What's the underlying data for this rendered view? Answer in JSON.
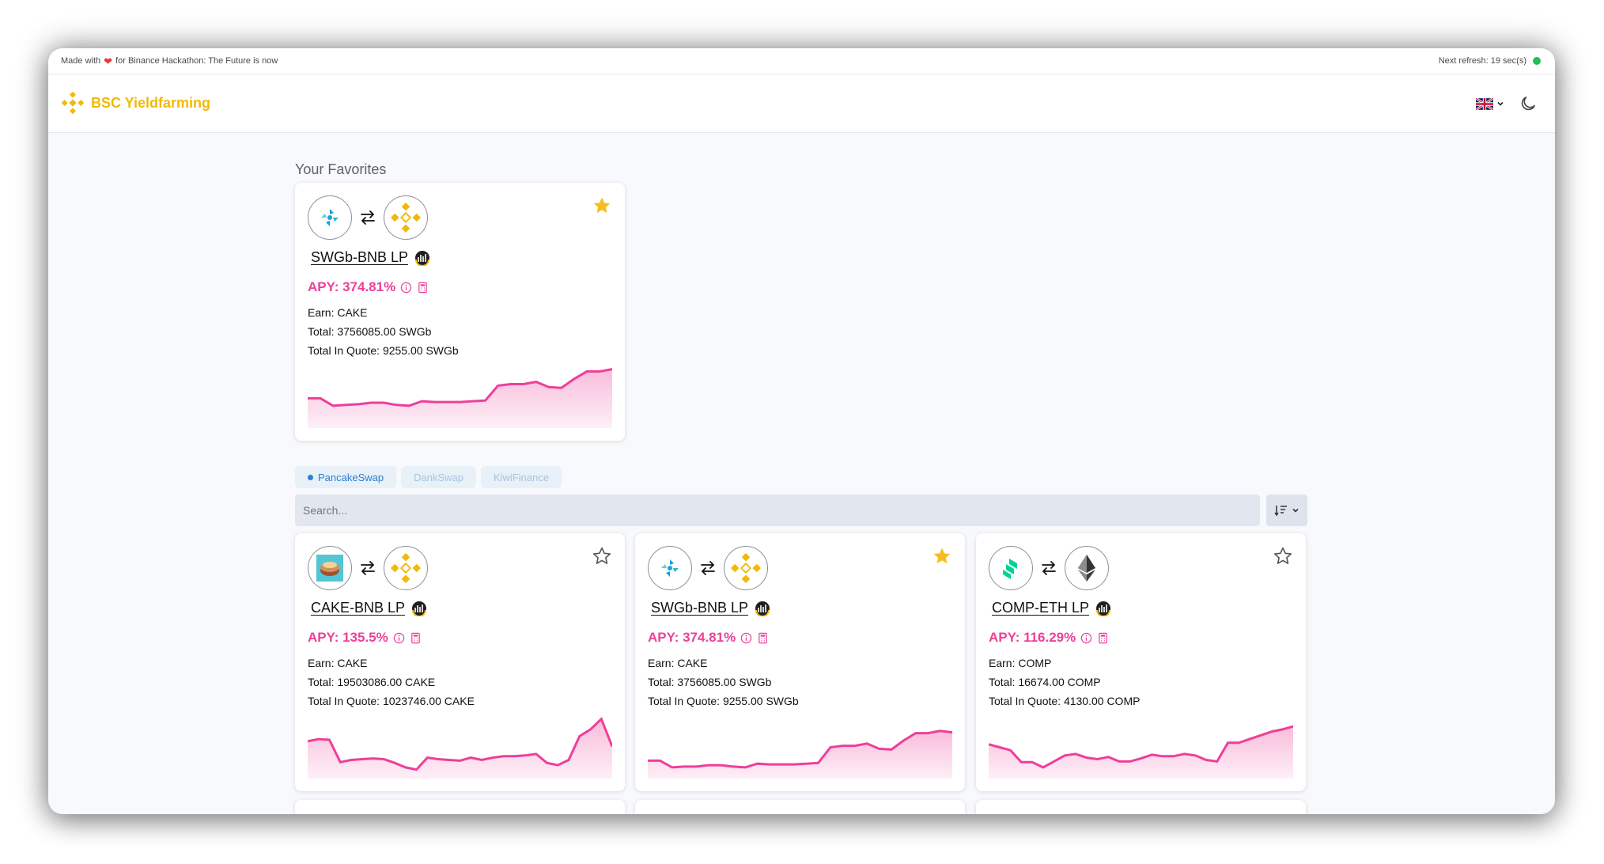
{
  "topbar": {
    "made_with": "Made with",
    "for_text": "for Binance Hackathon: The Future is now",
    "next_refresh": "Next refresh: 19 sec(s)"
  },
  "navbar": {
    "brand": "BSC Yieldfarming",
    "language_icon": "uk-flag-icon",
    "theme_icon": "moon-icon"
  },
  "favorites": {
    "title": "Your Favorites",
    "cards": [
      {
        "pair": "SWGb-BNB LP",
        "apy": "APY: 374.81%",
        "earn": "Earn: CAKE",
        "total": "Total: 3756085.00 SWGb",
        "total_quote": "Total In Quote: 9255.00 SWGb",
        "favorite": true,
        "token_a": "swgb-icon",
        "token_b": "bnb-icon",
        "spark": [
          40,
          40,
          30,
          31,
          32,
          34,
          34,
          31,
          30,
          36,
          35,
          35,
          35,
          36,
          37,
          57,
          59,
          59,
          62,
          55,
          54,
          66,
          76,
          76,
          79
        ]
      }
    ]
  },
  "tabs": [
    {
      "label": "PancakeSwap",
      "active": true
    },
    {
      "label": "DankSwap",
      "active": false
    },
    {
      "label": "KiwiFinance",
      "active": false
    }
  ],
  "search": {
    "placeholder": "Search..."
  },
  "sort_icon": "sort-desc-icon",
  "pools": [
    {
      "pair": "CAKE-BNB LP",
      "apy": "APY: 135.5%",
      "earn": "Earn: CAKE",
      "total": "Total: 19503086.00 CAKE",
      "total_quote": "Total In Quote: 1023746.00 CAKE",
      "favorite": false,
      "token_a": "cake-icon",
      "token_b": "bnb-icon",
      "spark": [
        50,
        53,
        52,
        22,
        25,
        26,
        27,
        26,
        21,
        15,
        12,
        28,
        26,
        25,
        24,
        28,
        25,
        28,
        30,
        30,
        31,
        33,
        21,
        18,
        25,
        57,
        66,
        80,
        43
      ]
    },
    {
      "pair": "SWGb-BNB LP",
      "apy": "APY: 374.81%",
      "earn": "Earn: CAKE",
      "total": "Total: 3756085.00 SWGb",
      "total_quote": "Total In Quote: 9255.00 SWGb",
      "favorite": true,
      "token_a": "swgb-icon",
      "token_b": "bnb-icon",
      "spark": [
        24,
        24,
        15,
        16,
        16,
        18,
        18,
        16,
        15,
        20,
        19,
        19,
        19,
        20,
        21,
        42,
        44,
        44,
        47,
        40,
        39,
        51,
        61,
        61,
        64,
        62
      ]
    },
    {
      "pair": "COMP-ETH LP",
      "apy": "APY: 116.29%",
      "earn": "Earn: COMP",
      "total": "Total: 16674.00 COMP",
      "total_quote": "Total In Quote: 4130.00 COMP",
      "favorite": false,
      "token_a": "comp-icon",
      "token_b": "eth-icon",
      "spark": [
        46,
        42,
        38,
        22,
        22,
        15,
        23,
        31,
        33,
        28,
        26,
        29,
        23,
        23,
        27,
        32,
        30,
        30,
        33,
        31,
        25,
        23,
        48,
        48,
        53,
        58,
        63,
        66,
        70
      ]
    }
  ]
}
